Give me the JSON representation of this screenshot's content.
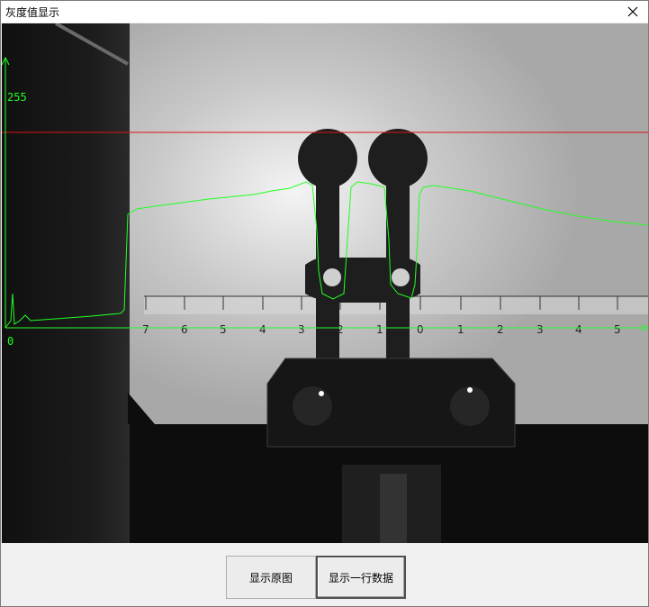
{
  "window": {
    "title": "灰度值显示"
  },
  "icons": {
    "close": "close-icon"
  },
  "plot": {
    "y_max_label": "255",
    "y_min_label": "0",
    "trace_color": "#22ff22",
    "threshold_color": "#e01414"
  },
  "ruler": {
    "labels": [
      "7",
      "6",
      "5",
      "4",
      "3",
      "2",
      "1",
      "0",
      "1",
      "2",
      "3",
      "4",
      "5"
    ]
  },
  "buttons": {
    "show_original": "显示原图",
    "show_row_data": "显示一行数据"
  }
}
